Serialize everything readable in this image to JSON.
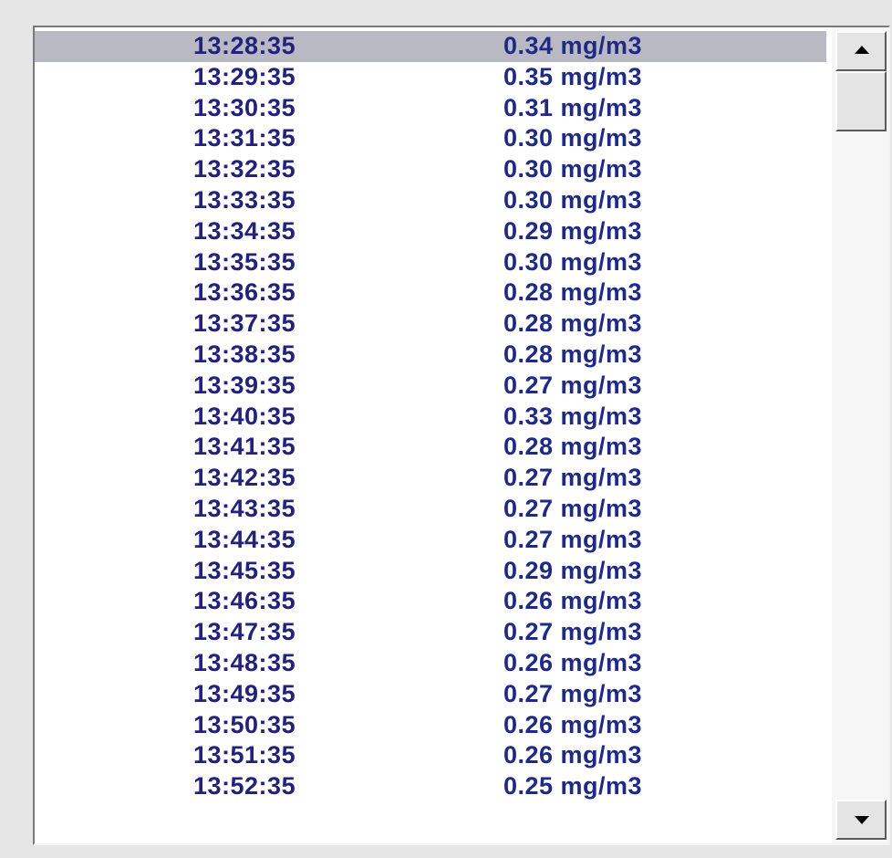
{
  "readings": [
    {
      "time": "13:28:35",
      "value": "0.34 mg/m3"
    },
    {
      "time": "13:29:35",
      "value": "0.35 mg/m3"
    },
    {
      "time": "13:30:35",
      "value": "0.31 mg/m3"
    },
    {
      "time": "13:31:35",
      "value": "0.30 mg/m3"
    },
    {
      "time": "13:32:35",
      "value": "0.30 mg/m3"
    },
    {
      "time": "13:33:35",
      "value": "0.30 mg/m3"
    },
    {
      "time": "13:34:35",
      "value": "0.29 mg/m3"
    },
    {
      "time": "13:35:35",
      "value": "0.30 mg/m3"
    },
    {
      "time": "13:36:35",
      "value": "0.28 mg/m3"
    },
    {
      "time": "13:37:35",
      "value": "0.28 mg/m3"
    },
    {
      "time": "13:38:35",
      "value": "0.28 mg/m3"
    },
    {
      "time": "13:39:35",
      "value": "0.27 mg/m3"
    },
    {
      "time": "13:40:35",
      "value": "0.33 mg/m3"
    },
    {
      "time": "13:41:35",
      "value": "0.28 mg/m3"
    },
    {
      "time": "13:42:35",
      "value": "0.27 mg/m3"
    },
    {
      "time": "13:43:35",
      "value": "0.27 mg/m3"
    },
    {
      "time": "13:44:35",
      "value": "0.27 mg/m3"
    },
    {
      "time": "13:45:35",
      "value": "0.29 mg/m3"
    },
    {
      "time": "13:46:35",
      "value": "0.26 mg/m3"
    },
    {
      "time": "13:47:35",
      "value": "0.27 mg/m3"
    },
    {
      "time": "13:48:35",
      "value": "0.26 mg/m3"
    },
    {
      "time": "13:49:35",
      "value": "0.27 mg/m3"
    },
    {
      "time": "13:50:35",
      "value": "0.26 mg/m3"
    },
    {
      "time": "13:51:35",
      "value": "0.26 mg/m3"
    },
    {
      "time": "13:52:35",
      "value": "0.25 mg/m3"
    }
  ],
  "selected_index": 0,
  "scrollbar": {
    "up_icon": "arrow-up-icon",
    "down_icon": "arrow-down-icon"
  },
  "colors": {
    "selection": "#b9b9c4",
    "text": "#1c1c6c"
  }
}
